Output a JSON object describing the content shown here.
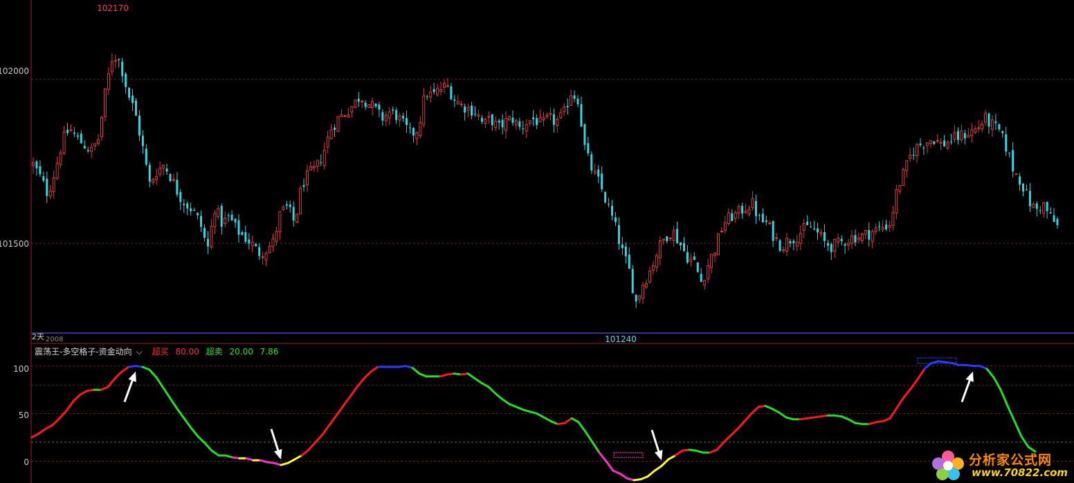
{
  "chart_data": [
    {
      "type": "candlestick",
      "y_ticks": [
        "102000",
        "101500"
      ],
      "annotations": {
        "high_label": "102170",
        "low_label": "101240"
      },
      "axis_note": "2天",
      "x_note": "2008",
      "ylim": [
        101230,
        102200
      ],
      "up_color": "#e03c3c",
      "down_color": "#33d6e0",
      "close_path": [
        101740,
        101700,
        101650,
        101720,
        101810,
        101850,
        101820,
        101800,
        101780,
        101820,
        101970,
        102080,
        102050,
        101960,
        101900,
        101800,
        101680,
        101720,
        101740,
        101700,
        101650,
        101620,
        101600,
        101560,
        101480,
        101610,
        101560,
        101580,
        101540,
        101520,
        101500,
        101470,
        101480,
        101500,
        101590,
        101610,
        101560,
        101680,
        101710,
        101730,
        101780,
        101850,
        101880,
        101900,
        101920,
        101950,
        101930,
        101910,
        101880,
        101900,
        101890,
        101860,
        101830,
        101850,
        101960,
        101950,
        101970,
        101980,
        101940,
        101920,
        101910,
        101900,
        101860,
        101880,
        101850,
        101870,
        101880,
        101850,
        101870,
        101880,
        101860,
        101880,
        101870,
        101890,
        101960,
        101940,
        101780,
        101720,
        101680,
        101620,
        101560,
        101480,
        101420,
        101320,
        101380,
        101420,
        101480,
        101520,
        101540,
        101500,
        101460,
        101440,
        101380,
        101440,
        101490,
        101560,
        101580,
        101590,
        101610,
        101620,
        101570,
        101560,
        101520,
        101490,
        101510,
        101520,
        101540,
        101550,
        101530,
        101500,
        101490,
        101500,
        101510,
        101520,
        101520,
        101530,
        101540,
        101550,
        101560,
        101670,
        101720,
        101780,
        101800,
        101810,
        101820,
        101800,
        101810,
        101820,
        101830,
        101840,
        101850,
        101880,
        101860,
        101840,
        101790,
        101720,
        101690,
        101630,
        101600,
        101620,
        101580,
        101550
      ]
    },
    {
      "type": "line",
      "title": "震荡王-多空格子-资金动向",
      "stats": [
        {
          "name": "超买",
          "value": "80.00",
          "color": "#ff3030"
        },
        {
          "name": "超卖",
          "value": "20.00",
          "color": "#30e030"
        },
        {
          "name": "",
          "value": "7.86",
          "color": "#30e030"
        }
      ],
      "y_ticks": [
        "100",
        "50",
        "0"
      ],
      "ylim": [
        -20,
        107
      ],
      "reference_lines": [
        100,
        80,
        50,
        20,
        0
      ],
      "segment_colors": {
        "up": "#ff1a1a",
        "down": "#22e022",
        "top": "#2a3aff",
        "bottom_fall": "#ff30c8",
        "bottom_rise": "#ffff30"
      },
      "x": [
        0,
        10,
        20,
        30,
        40,
        50,
        55,
        60,
        70,
        80,
        90,
        100,
        110,
        120,
        130,
        140,
        150,
        160,
        170,
        180,
        190,
        200,
        210,
        220,
        230,
        240,
        250,
        260,
        270,
        280,
        290,
        300,
        310,
        320,
        330,
        340,
        350,
        360,
        370,
        380,
        390,
        400,
        410,
        420,
        430,
        440,
        450,
        460,
        470,
        480,
        490,
        500,
        510,
        520,
        530,
        540,
        550,
        560,
        570,
        580,
        590,
        600,
        610,
        620,
        630,
        640,
        650,
        660,
        670,
        680,
        690,
        700,
        710,
        720,
        730,
        740,
        750,
        760,
        770,
        780,
        790,
        800,
        810,
        820,
        830,
        840,
        850,
        860,
        870,
        880,
        890,
        900,
        910,
        920,
        930,
        940,
        950,
        960,
        970,
        980,
        990,
        1000,
        1010,
        1020,
        1030,
        1040,
        1050,
        1060,
        1070,
        1080,
        1090,
        1100,
        1110,
        1120,
        1130,
        1140,
        1150,
        1160,
        1170,
        1180,
        1190,
        1200,
        1210,
        1220,
        1230,
        1240,
        1250,
        1260,
        1270,
        1280,
        1290,
        1300,
        1310,
        1320,
        1330,
        1340,
        1350,
        1360,
        1370,
        1380,
        1390,
        1400,
        1410,
        1420,
        1430,
        1440,
        1450,
        1460,
        1470,
        1480,
        1490,
        1500
      ],
      "values": [
        25,
        29,
        34,
        38,
        45,
        53,
        58,
        63,
        70,
        74,
        75,
        75,
        78,
        87,
        94,
        99,
        100,
        99,
        96,
        88,
        77,
        66,
        55,
        45,
        35,
        26,
        19,
        11,
        6,
        6,
        4,
        3,
        3,
        1,
        1,
        -1,
        -2,
        -4,
        -2,
        2,
        6,
        12,
        20,
        28,
        38,
        48,
        58,
        68,
        78,
        87,
        94,
        99,
        99,
        99,
        99,
        100,
        98,
        92,
        89,
        89,
        89,
        91,
        92,
        91,
        92,
        87,
        82,
        78,
        71,
        65,
        60,
        57,
        54,
        52,
        50,
        46,
        42,
        39,
        40,
        45,
        41,
        31,
        20,
        9,
        0,
        -10,
        -13,
        -18,
        -20,
        -19,
        -16,
        -10,
        -5,
        2,
        6,
        11,
        12,
        11,
        9,
        9,
        12,
        20,
        27,
        34,
        42,
        50,
        57,
        58,
        55,
        51,
        46,
        44,
        44,
        45,
        46,
        47,
        48,
        48,
        47,
        44,
        40,
        39,
        39,
        41,
        42,
        45,
        56,
        67,
        76,
        86,
        97,
        103,
        105,
        104,
        103,
        101,
        101,
        100,
        100,
        97,
        88,
        75,
        58,
        42,
        26,
        15,
        10
      ]
    }
  ],
  "logo": {
    "text": "分析家公式网",
    "url": "www.70822.com"
  }
}
